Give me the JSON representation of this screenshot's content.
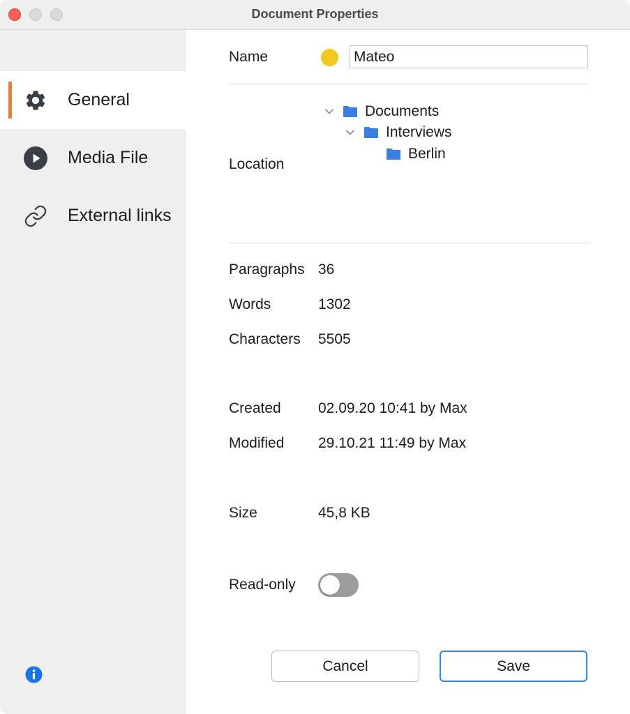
{
  "window": {
    "title": "Document Properties"
  },
  "sidebar": {
    "items": [
      {
        "label": "General",
        "icon": "gear-icon",
        "active": true
      },
      {
        "label": "Media File",
        "icon": "play-circle-icon",
        "active": false
      },
      {
        "label": "External links",
        "icon": "link-icon",
        "active": false
      }
    ],
    "info_icon": "info-icon"
  },
  "colors": {
    "accent": "#f07a3a",
    "name_dot": "#f0c91c",
    "folder": "#3b7de0",
    "save_border": "#3d86cf",
    "info": "#1a73e8"
  },
  "general": {
    "name_label": "Name",
    "name_value": "Mateo",
    "location_label": "Location",
    "location_tree": [
      {
        "label": "Documents",
        "expanded": true
      },
      {
        "label": "Interviews",
        "expanded": true
      },
      {
        "label": "Berlin",
        "expanded": false
      }
    ],
    "stats": [
      {
        "label": "Paragraphs",
        "value": "36"
      },
      {
        "label": "Words",
        "value": "1302"
      },
      {
        "label": "Characters",
        "value": "5505"
      }
    ],
    "created_label": "Created",
    "created_value": "02.09.20 10:41 by Max",
    "modified_label": "Modified",
    "modified_value": "29.10.21 11:49 by Max",
    "size_label": "Size",
    "size_value": "45,8 KB",
    "readonly_label": "Read-only",
    "readonly_on": false
  },
  "buttons": {
    "cancel": "Cancel",
    "save": "Save"
  }
}
